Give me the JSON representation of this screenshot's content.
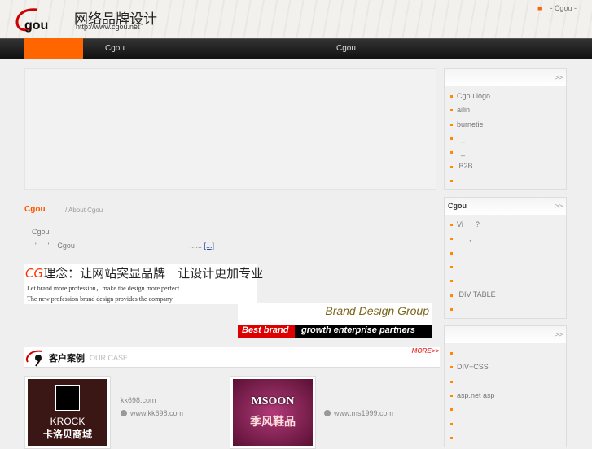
{
  "header": {
    "logo_text": "Cgou",
    "logo_cn": "网络品牌设计",
    "logo_url": "http://www.cgou.net",
    "top_link": "- Cgou -"
  },
  "nav": {
    "items": [
      "Cgou",
      "Cgou"
    ]
  },
  "about": {
    "title": "Cgou",
    "subtitle": "/ About Cgou",
    "line1": "Cgou",
    "line2": "\"     '    Cgou",
    "more_prefix": "......",
    "more_link": "[...]"
  },
  "slogan": {
    "cg": "CG",
    "headline": "理念：让网站突显品牌　让设计更加专业",
    "en1": "Let brand more profession，make the design more perfect",
    "en2": "The new profession brand design provides the company"
  },
  "brand": {
    "title": "Brand Design Group",
    "best": "Best brand",
    "tagline": "growth enterprise partners"
  },
  "cases": {
    "title_cn": "客户案例",
    "title_en": "OUR CASE",
    "more": "MORE>>",
    "items": [
      {
        "logo_text": "KROCK",
        "logo_cn": "卡洛贝商城",
        "name": "kk698.com",
        "url": "www.kk698.com"
      },
      {
        "logo_text": "MSOON",
        "logo_cn": "季风鞋品",
        "name": "",
        "url": "www.ms1999.com"
      }
    ]
  },
  "sidebar": [
    {
      "title": "",
      "more": ">>",
      "items": [
        "Cgou  logo",
        "ailin",
        "burnetie",
        "  _",
        "  _",
        " B2B",
        ""
      ]
    },
    {
      "title": "Cgou",
      "more": ">>",
      "items": [
        "Vi      ?",
        "      ,",
        "",
        "",
        "",
        " DIV TABLE",
        ""
      ]
    },
    {
      "title": "",
      "more": ">>",
      "items": [
        "",
        "DIV+CSS",
        "",
        "asp.net asp",
        "",
        "",
        ""
      ]
    }
  ],
  "colors": {
    "accent": "#ff6600",
    "nav_bg": "#111111",
    "brand_red": "#dd0000"
  }
}
